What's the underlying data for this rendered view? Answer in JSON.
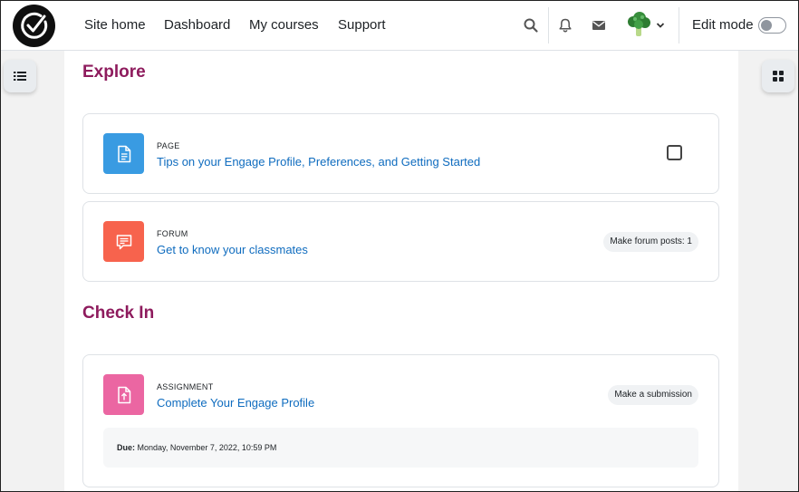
{
  "navbar": {
    "links": [
      "Site home",
      "Dashboard",
      "My courses",
      "Support"
    ],
    "edit_mode_label": "Edit mode",
    "edit_mode_on": false
  },
  "sections": [
    {
      "title": "Explore",
      "activities": [
        {
          "type": "PAGE",
          "name": "Tips on your Engage Profile, Preferences, and Getting Started",
          "icon": "page-icon",
          "color": "#399be2",
          "completion": "checkbox"
        },
        {
          "type": "FORUM",
          "name": "Get to know your classmates",
          "icon": "forum-icon",
          "color": "#f7634d",
          "badge": "Make forum posts: 1"
        }
      ]
    },
    {
      "title": "Check In",
      "activities": [
        {
          "type": "ASSIGNMENT",
          "name": "Complete Your Engage Profile",
          "icon": "assignment-icon",
          "color": "#eb66a2",
          "badge": "Make a submission",
          "due_label": "Due:",
          "due_value": "Monday, November 7, 2022, 10:59 PM"
        }
      ]
    }
  ],
  "colors": {
    "section_title": "#8e1b5d",
    "link": "#0f6cbf"
  }
}
